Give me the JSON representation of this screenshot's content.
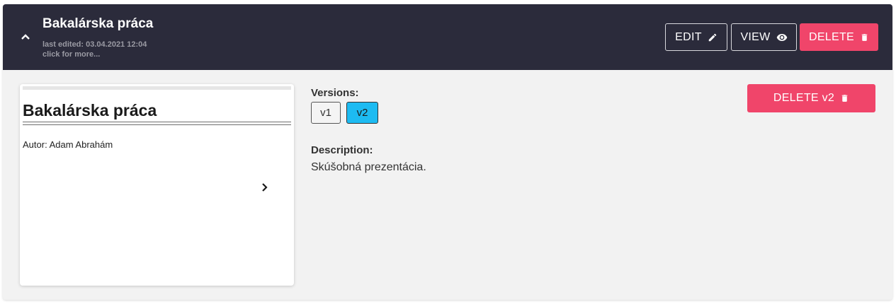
{
  "header": {
    "title": "Bakalárska práca",
    "last_edited": "last edited: 03.04.2021 12:04",
    "more_hint": "click for more...",
    "collapse_icon": "chevron-up-icon",
    "buttons": {
      "edit_label": "EDIT",
      "view_label": "VIEW",
      "delete_label": "DELETE"
    }
  },
  "preview": {
    "title": "Bakalárska práca",
    "author": "Autor: Adam Abrahám",
    "next_icon": "chevron-right-icon"
  },
  "versions": {
    "label": "Versions:",
    "items": [
      "v1",
      "v2"
    ],
    "selected": "v2",
    "delete_label": "DELETE v2"
  },
  "description": {
    "label": "Description:",
    "text": "Skúšobná prezentácia."
  },
  "colors": {
    "header_bg": "#2b2b3b",
    "danger": "#f0456a",
    "selected_version": "#1dbbf2",
    "body_bg": "#f2f2f2"
  }
}
